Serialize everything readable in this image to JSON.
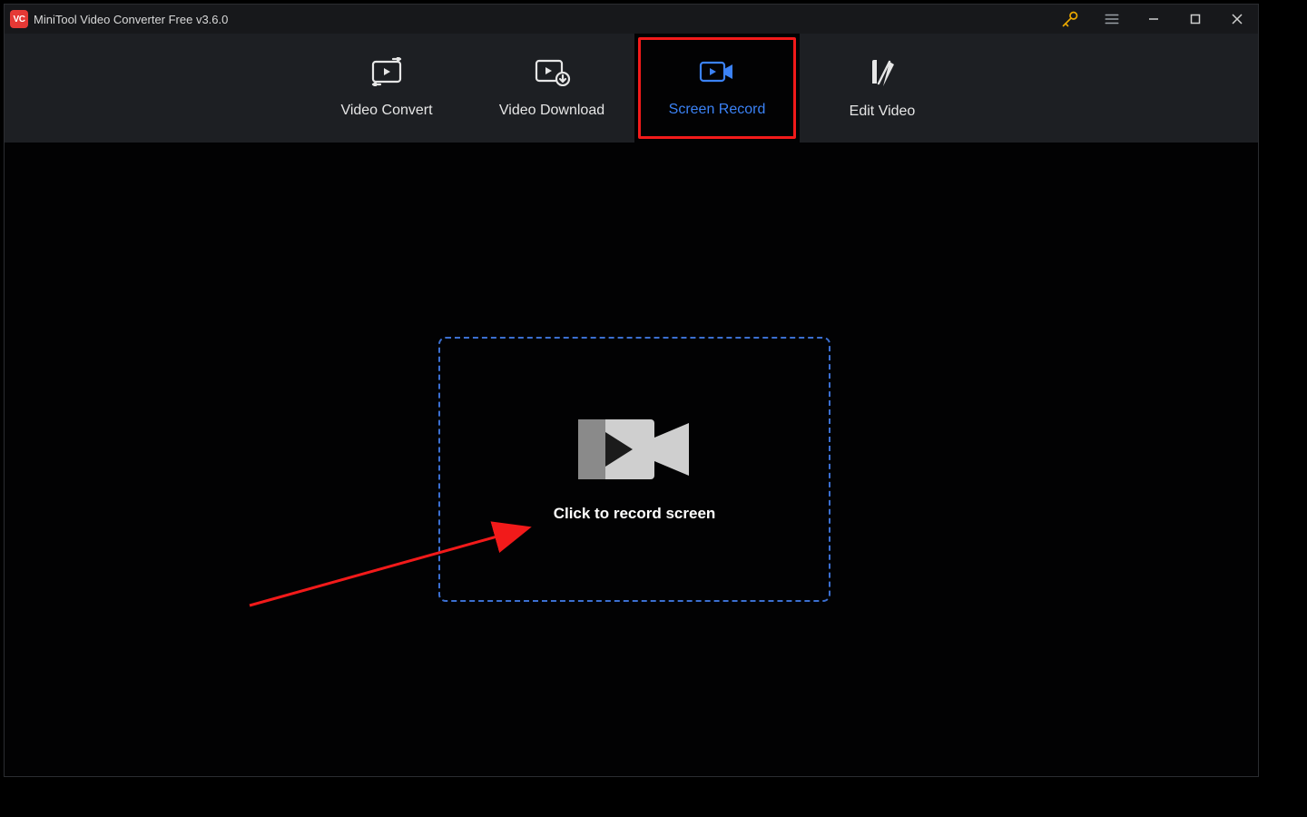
{
  "titlebar": {
    "app_logo_text": "VC",
    "title": "MiniTool Video Converter Free v3.6.0"
  },
  "tabs": {
    "convert": "Video Convert",
    "download": "Video Download",
    "record": "Screen Record",
    "edit": "Edit Video"
  },
  "content": {
    "record_prompt": "Click to record screen"
  }
}
